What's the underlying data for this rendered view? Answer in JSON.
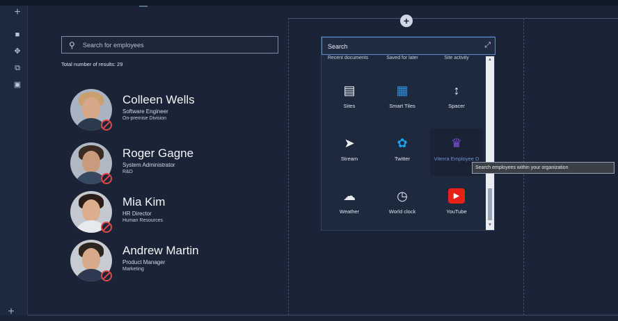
{
  "employee_search": {
    "placeholder": "Search for employees",
    "total_label": "Total number of results: 29"
  },
  "employees": [
    {
      "name": "Colleen Wells",
      "title": "Software Engineer",
      "department": "On-premise Division"
    },
    {
      "name": "Roger Gagne",
      "title": "System Administrator",
      "department": "R&D"
    },
    {
      "name": "Mia Kim",
      "title": "HR Director",
      "department": "Human Resources"
    },
    {
      "name": "Andrew Martin",
      "title": "Product Manager",
      "department": "Marketing"
    }
  ],
  "toolbox": {
    "search_placeholder": "Search",
    "categories": [
      "Recent documents",
      "Saved for later",
      "Site activity"
    ],
    "tiles": [
      {
        "label": "Sites",
        "icon": "sites-icon"
      },
      {
        "label": "Smart Tiles",
        "icon": "smart-tiles-icon"
      },
      {
        "label": "Spacer",
        "icon": "spacer-icon"
      },
      {
        "label": "Stream",
        "icon": "stream-icon"
      },
      {
        "label": "Twitter",
        "icon": "twitter-icon"
      },
      {
        "label": "Viterra Employee D",
        "icon": "employee-directory-icon"
      },
      {
        "label": "Weather",
        "icon": "weather-icon"
      },
      {
        "label": "World clock",
        "icon": "world-clock-icon"
      },
      {
        "label": "YouTube",
        "icon": "youtube-icon"
      }
    ],
    "tooltip": "Search employees within your organization"
  },
  "colors": {
    "background": "#1b2638",
    "presence_busy": "#e04848",
    "twitter": "#1da1f2",
    "youtube": "#e62117",
    "smart_tiles": "#2f8fd8",
    "employee_dir": "#7b4fd6"
  }
}
